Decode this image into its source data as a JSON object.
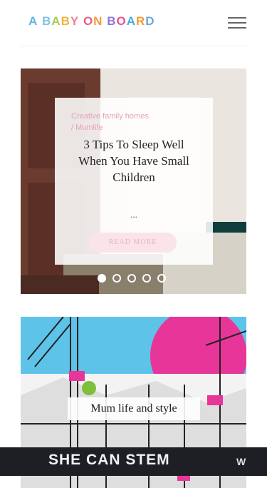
{
  "header": {
    "logo_letters": [
      {
        "ch": "A",
        "color": "#5fb6e3"
      },
      {
        "ch": " ",
        "color": "#ffffff"
      },
      {
        "ch": "B",
        "color": "#7cc3e8"
      },
      {
        "ch": "A",
        "color": "#a6cf4e"
      },
      {
        "ch": "B",
        "color": "#f0b53b"
      },
      {
        "ch": "Y",
        "color": "#ee7d96"
      },
      {
        "ch": " ",
        "color": "#ffffff"
      },
      {
        "ch": "O",
        "color": "#e85c8b"
      },
      {
        "ch": "N",
        "color": "#f49b3c"
      },
      {
        "ch": " ",
        "color": "#ffffff"
      },
      {
        "ch": "B",
        "color": "#8c7bd1"
      },
      {
        "ch": "O",
        "color": "#e9528c"
      },
      {
        "ch": "A",
        "color": "#3fb0d9"
      },
      {
        "ch": "R",
        "color": "#f39b35"
      },
      {
        "ch": "D",
        "color": "#6aa8e0"
      }
    ],
    "menu_icon": "hamburger-menu-icon"
  },
  "hero": {
    "category_1": "Creative family homes",
    "category_2": "/  Mumlife",
    "title": "3 Tips To Sleep Well When You Have Small Children",
    "excerpt": "...",
    "read_more": "READ MORE",
    "slides": 5,
    "active_slide": 1
  },
  "card2": {
    "label": "Mum life and style"
  },
  "ad": {
    "text": "SHE CAN STEM",
    "logo": "W"
  },
  "colors": {
    "accent_pink": "#e6a3b8",
    "button_bg": "#fbe3ea",
    "ad_bg": "#1e1f24"
  }
}
